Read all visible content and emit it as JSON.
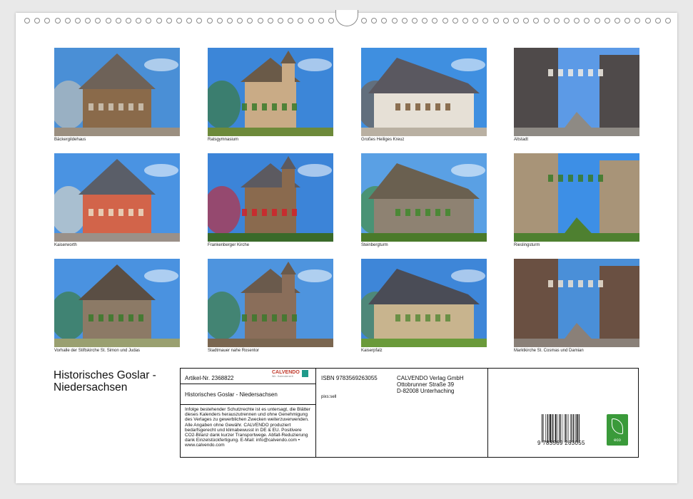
{
  "calendar_title": "Historisches Goslar -\n Niedersachsen",
  "photos": [
    {
      "caption": "Bäckergildehaus",
      "sky": "#4a8fd6",
      "main": "#8a6a4a",
      "roof": "#6e6258",
      "accent": "#cfc6b6",
      "ground": "#9b8f80"
    },
    {
      "caption": "Ratsgymnasium",
      "sky": "#3c86d8",
      "main": "#c9ab86",
      "roof": "#6a5a48",
      "accent": "#3a7a2a",
      "ground": "#6d8a3a"
    },
    {
      "caption": "Großes Heiliges Kreuz",
      "sky": "#3f8fe0",
      "main": "#e6e0d6",
      "roof": "#5a5860",
      "accent": "#7a5a3a",
      "ground": "#b9b0a2"
    },
    {
      "caption": "Altstadt",
      "sky": "#5c9ae6",
      "main": "#4f4a4a",
      "roof": "#3e3a3a",
      "accent": "#f0ece4",
      "ground": "#8e8a84"
    },
    {
      "caption": "Kaiserworth",
      "sky": "#4a93e2",
      "main": "#d2644a",
      "roof": "#5a5e68",
      "accent": "#eadcc4",
      "ground": "#9a9088"
    },
    {
      "caption": "Frankenberger Kirche",
      "sky": "#3c84d8",
      "main": "#8a6a4e",
      "roof": "#5c5a60",
      "accent": "#d0222a",
      "ground": "#3a6a2a"
    },
    {
      "caption": "Steinbergturm",
      "sky": "#5aa0e4",
      "main": "#8e8272",
      "roof": "#6a6050",
      "accent": "#3f8a2c",
      "ground": "#4a7a2a"
    },
    {
      "caption": "Rieslingsturm",
      "sky": "#3d8fe6",
      "main": "#a89478",
      "roof": "#4a4a52",
      "accent": "#3a7a28",
      "ground": "#4e8030"
    },
    {
      "caption": "Vorhalle der Stiftskirche St. Simon und Judas",
      "sky": "#4a92e0",
      "main": "#8c7a66",
      "roof": "#5a4e44",
      "accent": "#3a7a2a",
      "ground": "#9aa070"
    },
    {
      "caption": "Stadtmauer nahe Rosentor",
      "sky": "#4e94de",
      "main": "#8a6e5a",
      "roof": "#6a5a4c",
      "accent": "#3c7a2c",
      "ground": "#7a6650"
    },
    {
      "caption": "Kaiserpfalz",
      "sky": "#3e86d8",
      "main": "#c8b48e",
      "roof": "#4a4c56",
      "accent": "#5a8a3a",
      "ground": "#6a9a3a"
    },
    {
      "caption": "Marktkirche St. Cosmas und Damian",
      "sky": "#4a8fd8",
      "main": "#6a5042",
      "roof": "#3a4a40",
      "accent": "#eae2d4",
      "ground": "#8a8078"
    }
  ],
  "info": {
    "article": "Artikel-Nr. 2368822",
    "isbn": "ISBN 9783569263055",
    "logo": "CALVENDO",
    "logo_sub": "Wir. Kalenderzeit",
    "product_title": "Historisches Goslar - Niedersachsen",
    "author": "pixs:sell",
    "publisher_lines": [
      "CALVENDO Verlag GmbH",
      "Ottobrunner Straße 39",
      "D-82008 Unterhaching"
    ],
    "legal": "Infolge bestehender Schutzrechte ist es untersagt, die Blätter dieses Kalenders herauszutrennen und ohne Genehmigung des Verlages zu gewerblichen Zwecken weiterzuverwenden. Alle Angaben ohne Gewähr. CALVENDO produziert bedarfsgerecht und klimabewusst in DE & EU. Positivere CO2-Bilanz dank kurzer Transportwege. Abfall-Reduzierung dank Einzelstückfertigung. E-Mail: info@calvendo.com • www.calvendo.com",
    "barcode_number": "9  783569  263055",
    "eco_label": "eco"
  }
}
